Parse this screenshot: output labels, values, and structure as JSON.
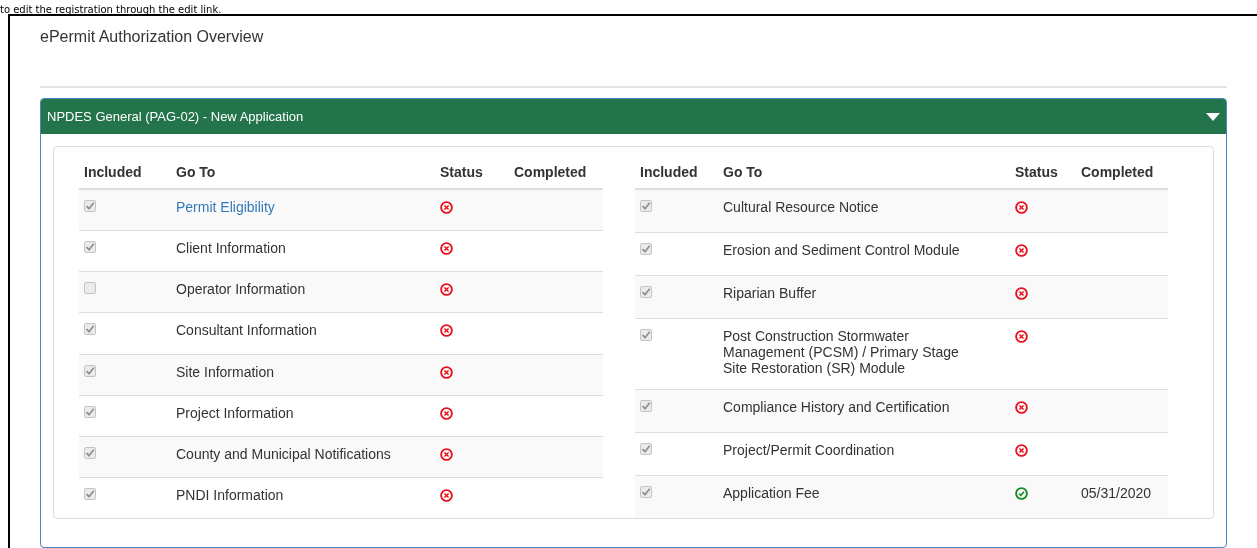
{
  "intro_text": "to edit the registration through the edit link.",
  "page_title": "ePermit Authorization Overview",
  "panel": {
    "title": "NPDES General (PAG-02) - New Application",
    "expanded": true
  },
  "tables": [
    {
      "columns": [
        "Included",
        "Go To",
        "Status",
        "Completed"
      ],
      "rows": [
        {
          "included": true,
          "label": "Permit Eligibility",
          "link": true,
          "complete": false
        },
        {
          "included": true,
          "label": "Client Information",
          "link": false,
          "complete": false
        },
        {
          "included": false,
          "label": "Operator Information",
          "link": false,
          "complete": false
        },
        {
          "included": true,
          "label": "Consultant Information",
          "link": false,
          "complete": false
        },
        {
          "included": true,
          "label": "Site Information",
          "link": false,
          "complete": false
        },
        {
          "included": true,
          "label": "Project Information",
          "link": false,
          "complete": false
        },
        {
          "included": true,
          "label": "County and Municipal Notifications",
          "link": false,
          "complete": false
        },
        {
          "included": true,
          "label": "PNDI Information",
          "link": false,
          "complete": false
        }
      ]
    },
    {
      "columns": [
        "Included",
        "Go To",
        "Status",
        "Completed"
      ],
      "rows": [
        {
          "included": true,
          "label": "Cultural Resource Notice",
          "link": false,
          "complete": false
        },
        {
          "included": true,
          "label": "Erosion and Sediment Control Module",
          "link": false,
          "complete": false
        },
        {
          "included": true,
          "label": "Riparian Buffer",
          "link": false,
          "complete": false
        },
        {
          "included": true,
          "label": "Post Construction Stormwater Management (PCSM) / Primary Stage Site Restoration (SR) Module",
          "link": false,
          "complete": false
        },
        {
          "included": true,
          "label": "Compliance History and Certification",
          "link": false,
          "complete": false
        },
        {
          "included": true,
          "label": "Project/Permit Coordination",
          "link": false,
          "complete": false
        },
        {
          "included": true,
          "label": "Application Fee",
          "link": false,
          "complete": true,
          "completed": "05/31/2020"
        }
      ]
    }
  ]
}
